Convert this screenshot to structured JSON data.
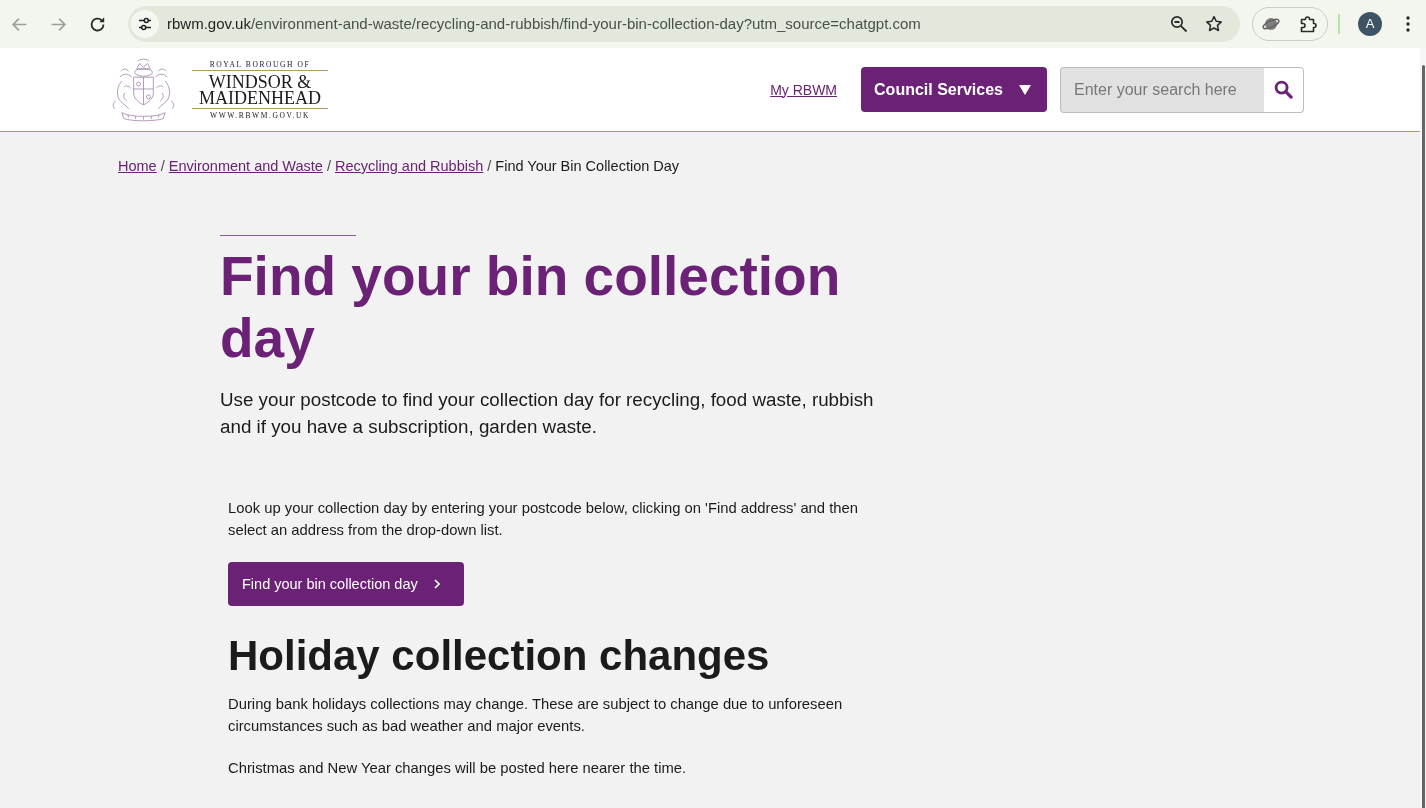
{
  "browser": {
    "nav_buttons": [
      {
        "kind": "back",
        "disabled": true
      },
      {
        "kind": "forward",
        "disabled": true
      },
      {
        "kind": "reload",
        "disabled": false
      }
    ],
    "address_bar": {
      "host": "rbwm.gov.uk",
      "path": "/environment-and-waste/recycling-and-rubbish/find-your-bin-collection-day?utm_source=chatgpt.com"
    },
    "profile": {
      "initial": "A"
    }
  },
  "header": {
    "logo": {
      "top_line": "ROYAL BOROUGH OF",
      "name_lines": [
        "WINDSOR &",
        "MAIDENHEAD"
      ],
      "web_address": "WWW.RBWM.GOV.UK"
    },
    "account_link": "My RBWM",
    "services_button": "Council Services",
    "search": {
      "placeholder": "Enter your search here"
    }
  },
  "breadcrumbs": [
    {
      "label": "Home",
      "current": false,
      "separator": "/"
    },
    {
      "label": "Environment and Waste",
      "current": false,
      "separator": "/"
    },
    {
      "label": "Recycling and Rubbish",
      "current": false,
      "separator": "/"
    },
    {
      "label": "Find Your Bin Collection Day",
      "current": true
    }
  ],
  "page": {
    "title": "Find your bin collection day",
    "intro": "Use your postcode to find your collection day for recycling, food waste, rubbish and if you have a subscription, garden waste.",
    "lookup": {
      "text": "Look up your collection day by entering your postcode below, clicking on 'Find address' and then select an address from the drop-down list.",
      "button": "Find your bin collection day"
    },
    "holiday": {
      "heading": "Holiday collection changes",
      "paragraphs": [
        "During bank holidays collections may change. These are subject to change due to unforeseen circumstances such as bad weather and major events.",
        "Christmas and New Year changes will be posted here nearer the time."
      ]
    }
  }
}
